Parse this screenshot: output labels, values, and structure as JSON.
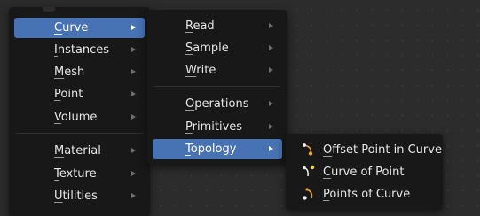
{
  "menu_main": {
    "items": [
      {
        "label": "Curve",
        "mnemonic": "C",
        "rest": "urve"
      },
      {
        "label": "Instances",
        "mnemonic": "I",
        "rest": "nstances"
      },
      {
        "label": "Mesh",
        "mnemonic": "M",
        "rest": "esh"
      },
      {
        "label": "Point",
        "mnemonic": "P",
        "rest": "oint"
      },
      {
        "label": "Volume",
        "mnemonic": "V",
        "rest": "olume"
      },
      {
        "label": "Material",
        "mnemonic": "M",
        "rest": "aterial"
      },
      {
        "label": "Texture",
        "mnemonic": "T",
        "rest": "exture"
      },
      {
        "label": "Utilities",
        "mnemonic": "U",
        "rest": "tilities"
      }
    ]
  },
  "menu_curve": {
    "items": [
      {
        "label": "Read",
        "mnemonic": "R",
        "rest": "ead"
      },
      {
        "label": "Sample",
        "mnemonic": "S",
        "rest": "ample"
      },
      {
        "label": "Write",
        "mnemonic": "W",
        "rest": "rite"
      },
      {
        "label": "Operations",
        "mnemonic": "O",
        "rest": "perations"
      },
      {
        "label": "Primitives",
        "mnemonic": "P",
        "rest": "rimitives"
      },
      {
        "label": "Topology",
        "mnemonic": "T",
        "rest": "opology"
      }
    ]
  },
  "menu_topology": {
    "items": [
      {
        "label": "Offset Point in Curve",
        "mnemonic": "O",
        "rest": "ffset Point in Curve",
        "icon": "offset-point-node-icon"
      },
      {
        "label": "Curve of Point",
        "mnemonic": "C",
        "rest": "urve of Point",
        "icon": "curve-of-point-node-icon"
      },
      {
        "label": "Points of Curve",
        "mnemonic": "P",
        "rest": "oints of Curve",
        "icon": "points-of-curve-node-icon"
      }
    ]
  },
  "colors": {
    "menu_bg": "#181818",
    "highlight": "#4772b3",
    "text": "#e6e6e6",
    "icon_orange": "#f0a030",
    "icon_yellow": "#f6d13a",
    "icon_white": "#f0f0f0"
  }
}
